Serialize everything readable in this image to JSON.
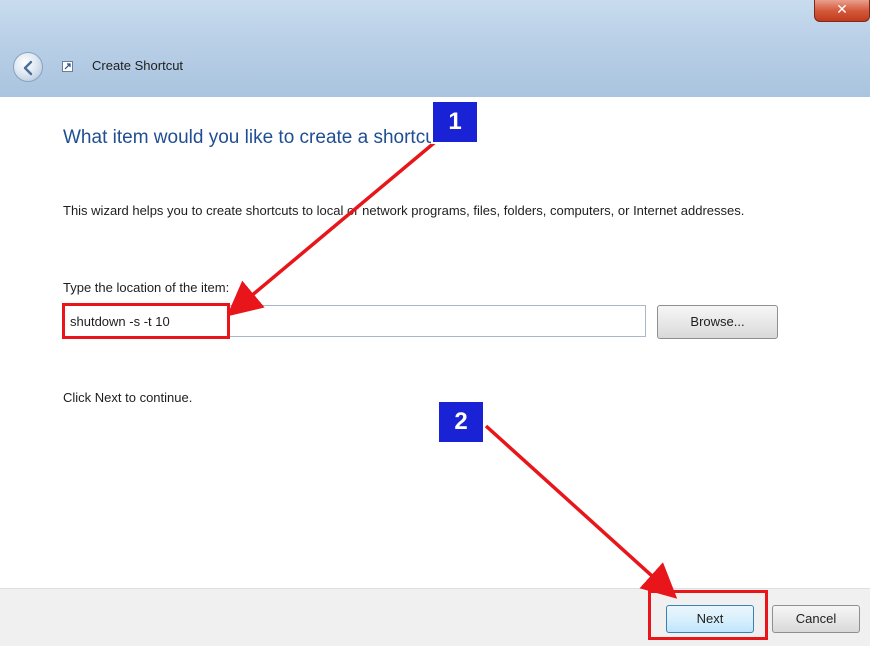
{
  "window": {
    "title": "Create Shortcut",
    "close_glyph": "✕"
  },
  "wizard": {
    "heading": "What item would you like to create a shortcut for?",
    "description": "This wizard helps you to create shortcuts to local or network programs, files, folders, computers, or Internet addresses.",
    "field_label": "Type the location of the item:",
    "location_value": "shutdown -s -t 10",
    "browse_label": "Browse...",
    "continue_text": "Click Next to continue."
  },
  "footer": {
    "next_label": "Next",
    "cancel_label": "Cancel"
  },
  "annotations": {
    "step1": "1",
    "step2": "2",
    "highlight_color": "#e8161a",
    "badge_color": "#1a22d6"
  },
  "icons": {
    "back": "back-arrow-icon",
    "app": "shortcut-icon",
    "close": "close-icon"
  }
}
